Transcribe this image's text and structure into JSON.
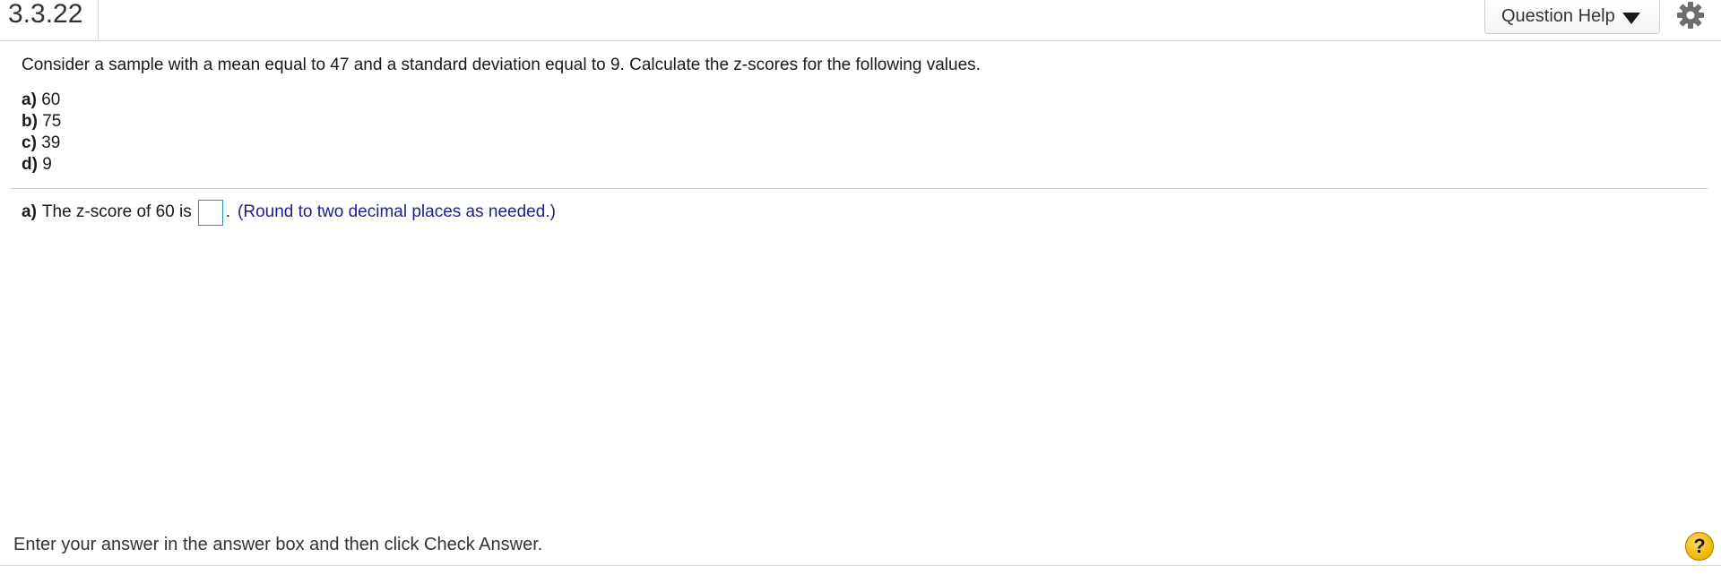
{
  "header": {
    "question_number": "3.3.22",
    "help_button_label": "Question Help",
    "help_icon": "caret-down-icon",
    "settings_icon": "gear-icon"
  },
  "question": {
    "stem": "Consider a sample with a mean equal to 47 and a standard deviation equal to 9. Calculate the z-scores for the following values.",
    "parts": [
      {
        "label": "a)",
        "value": "60"
      },
      {
        "label": "b)",
        "value": "75"
      },
      {
        "label": "c)",
        "value": "39"
      },
      {
        "label": "d)",
        "value": "9"
      }
    ]
  },
  "answer": {
    "part_label": "a)",
    "prompt": "The z-score of 60 is",
    "input_value": "",
    "after_input": ".",
    "hint": "(Round to two decimal places as needed.)"
  },
  "footer": {
    "instruction": "Enter your answer in the answer box and then click Check Answer.",
    "help_symbol": "?"
  },
  "colors": {
    "hint_text": "#1f1f8a",
    "input_border": "#2a8fbf",
    "help_circle": "#f0b400"
  }
}
